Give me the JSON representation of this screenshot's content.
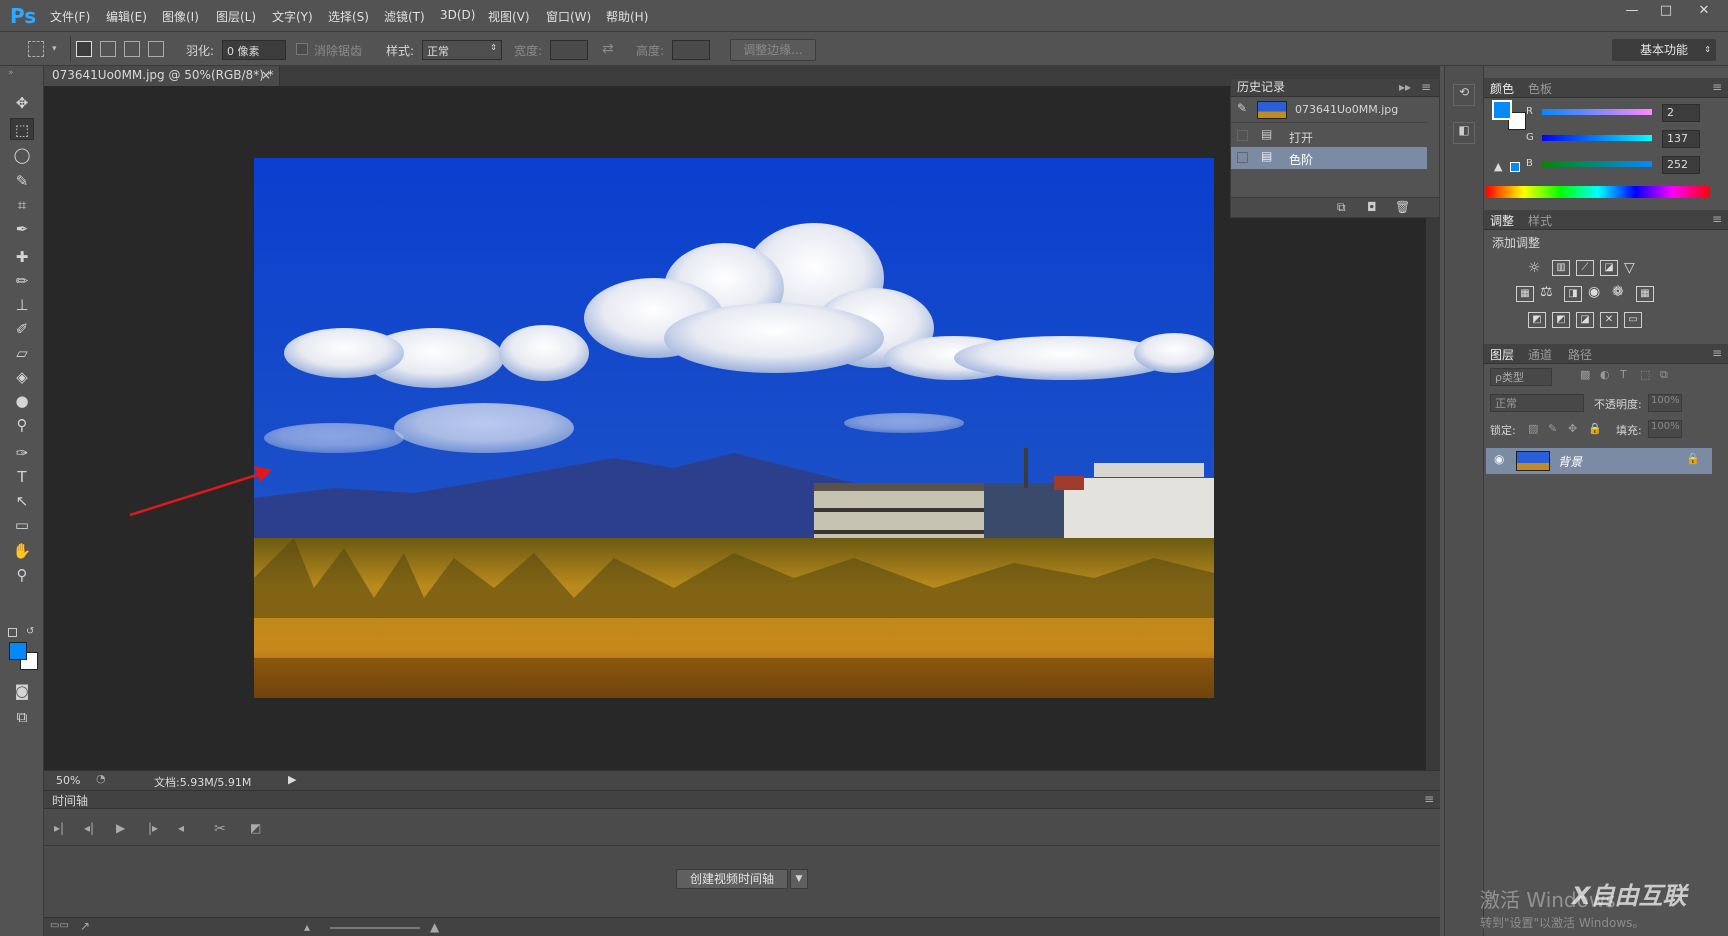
{
  "app": {
    "logo": "Ps"
  },
  "menu": [
    "文件(F)",
    "编辑(E)",
    "图像(I)",
    "图层(L)",
    "文字(Y)",
    "选择(S)",
    "滤镜(T)",
    "3D(D)",
    "视图(V)",
    "窗口(W)",
    "帮助(H)"
  ],
  "window_controls": {
    "minimize": "—",
    "maximize": "□",
    "close": "✕"
  },
  "options": {
    "feather_label": "羽化:",
    "feather_value": "0 像素",
    "antialias_label": "消除锯齿",
    "style_label": "样式:",
    "style_value": "正常",
    "width_label": "宽度:",
    "height_label": "高度:",
    "refine_edge": "调整边缘...",
    "workspace": "基本功能"
  },
  "document": {
    "tab_title": "073641Uo0MM.jpg @ 50%(RGB/8*) *",
    "tab_close": "×",
    "zoom": "50%",
    "doc_info": "文档:5.93M/5.91M"
  },
  "history": {
    "title": "历史记录",
    "snapshot": "073641Uo0MM.jpg",
    "items": [
      "打开",
      "色阶"
    ]
  },
  "color_panel": {
    "tabs": [
      "颜色",
      "色板"
    ],
    "r_label": "R",
    "r_value": "2",
    "g_label": "G",
    "g_value": "137",
    "b_label": "B",
    "b_value": "252",
    "foreground": "#0289fc"
  },
  "adjustments": {
    "tabs": [
      "调整",
      "样式"
    ],
    "title": "添加调整"
  },
  "layers": {
    "tabs": [
      "图层",
      "通道",
      "路径"
    ],
    "filter_label": "ρ类型",
    "blend_mode": "正常",
    "opacity_label": "不透明度:",
    "opacity_value": "100%",
    "lock_label": "锁定:",
    "fill_label": "填充:",
    "fill_value": "100%",
    "layer_name": "背景"
  },
  "timeline": {
    "title": "时间轴",
    "create_button": "创建视频时间轴"
  },
  "watermark": {
    "line1": "激活 Windows",
    "line2": "转到\"设置\"以激活 Windows。",
    "brand": "X自由互联"
  }
}
